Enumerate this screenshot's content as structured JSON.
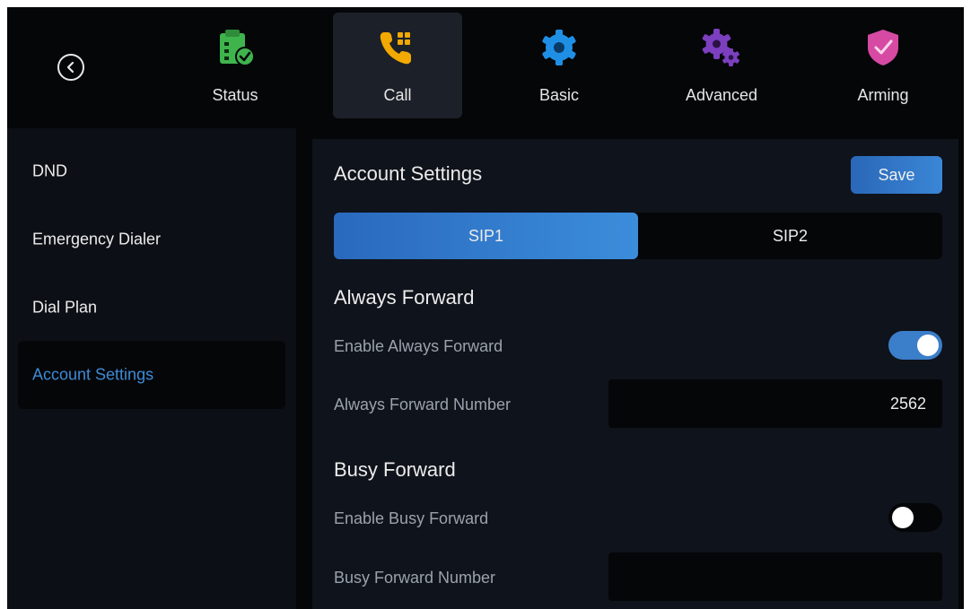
{
  "nav": {
    "back_icon": "chevron-left-icon",
    "tabs": [
      {
        "label": "Status",
        "icon": "clipboard-check-icon",
        "color": "#3fb44d"
      },
      {
        "label": "Call",
        "icon": "phone-keypad-icon",
        "color": "#f2a900",
        "active": true
      },
      {
        "label": "Basic",
        "icon": "gear-icon",
        "color": "#1f8fe6"
      },
      {
        "label": "Advanced",
        "icon": "gears-icon",
        "color": "#7b3fbf"
      },
      {
        "label": "Arming",
        "icon": "shield-check-icon",
        "color": "#d64aa4"
      }
    ]
  },
  "sidebar": {
    "items": [
      {
        "label": "DND"
      },
      {
        "label": "Emergency Dialer"
      },
      {
        "label": "Dial Plan"
      },
      {
        "label": "Account Settings",
        "active": true
      }
    ]
  },
  "main": {
    "title": "Account Settings",
    "save_label": "Save",
    "segments": [
      {
        "label": "SIP1",
        "active": true
      },
      {
        "label": "SIP2"
      }
    ],
    "always_forward": {
      "title": "Always Forward",
      "enable_label": "Enable Always Forward",
      "enabled": true,
      "number_label": "Always Forward Number",
      "number_value": "2562"
    },
    "busy_forward": {
      "title": "Busy Forward",
      "enable_label": "Enable Busy Forward",
      "enabled": false,
      "number_label": "Busy Forward Number",
      "number_value": ""
    }
  },
  "colors": {
    "accent": "#3b8ddb",
    "active_sidebar_text": "#3d8bd6",
    "background": "#050608"
  }
}
